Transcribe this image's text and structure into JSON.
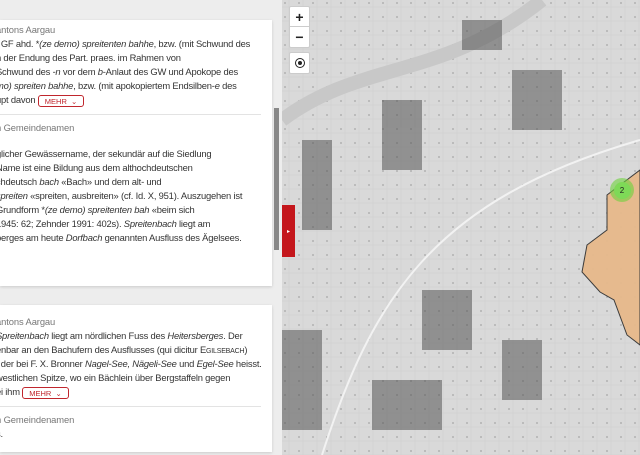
{
  "card1": {
    "section": "antons Aargau",
    "lines": [
      "GF ahd. ",
      "(ze demo) spreitenten bahhe",
      ", bzw. (mit Schwund des",
      "n der Endung des Part. praes. im Rahmen von",
      "Schwund des ",
      "-n",
      " vor dem ",
      "b",
      "-Anlaut des GW und Apokope des",
      "mo) spreiten bahhe",
      ", bzw. (mit apokopiertem Endsilben-",
      "e",
      " des",
      "upt davon"
    ],
    "more": "MEHR",
    "section2": "n Gemeindenamen",
    "body": [
      "glicher Gewässername, der sekundär auf die Siedlung",
      "Name ist eine Bildung aus dem althochdeutschen",
      "chdeutsch ",
      "bach",
      " «Bach» und dem alt- und",
      "spreiten",
      " «spreiten, ausbreiten» (cf. Id. X, 951). Auszugehen ist",
      "Grundform *",
      "(ze demo) spreitenten bah",
      " «beim sich",
      "1945: 62; Zehnder 1991: 402s). ",
      "Spreitenbach",
      " liegt am",
      "berges am heute ",
      "Dorfbach",
      " genannten Ausfluss des Ägelsees."
    ]
  },
  "card2": {
    "section": "antons Aargau",
    "lines": [
      "Spreitenbach",
      " liegt am nördlichen Fuss des ",
      "Heitersberges",
      ". Der",
      "enbar an den Bachufern des Ausflusses (qui dicitur ",
      "Egilsebach",
      ")",
      ", der bei F. X. Bronner ",
      "Nagel-See, Nägeli-See",
      " und ",
      "Egel-See",
      " heisst.",
      "westlichen Spitze, wo ein Bächlein über Bergstaffeln gegen",
      "ei ihm"
    ],
    "more": "MEHR",
    "section2": "n Gemeindenamen",
    "body": "s."
  },
  "map": {
    "zoom_in": "+",
    "zoom_out": "−",
    "locate_icon": "crosshair-icon",
    "cluster_count": "2",
    "region_color": "#e7b98b",
    "toggle_icon": "▸"
  }
}
